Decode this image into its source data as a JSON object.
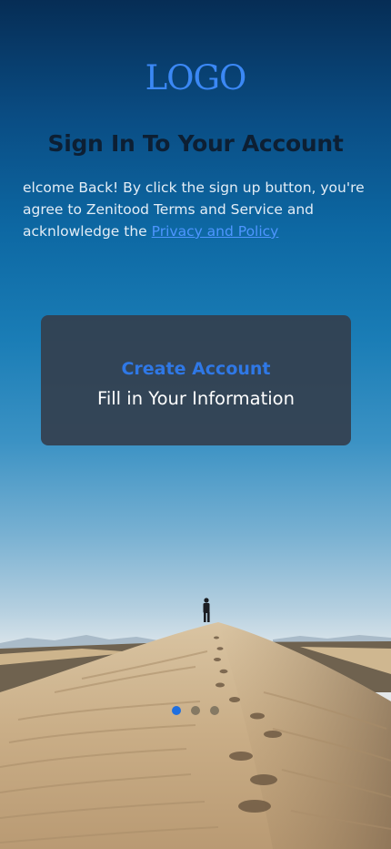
{
  "logo": "LOGO",
  "title": "Sign In To Your Account",
  "subtitle": {
    "text": "elcome Back! By click the sign up button, you're agree to Zenitood Terms and Service and acknlowledge the ",
    "link": "Privacy and Policy"
  },
  "card": {
    "title": "Create Account",
    "subtitle": "Fill in Your Information"
  },
  "pagination": {
    "count": 3,
    "active_index": 0
  },
  "colors": {
    "logo": "#3b88f5",
    "link": "#4e95ff",
    "card_title": "#2f78e6",
    "card_bg": "#34404f",
    "dot_active": "#1f6fe0"
  },
  "background": {
    "description_icon": "desert-dune-hiker-photo"
  }
}
